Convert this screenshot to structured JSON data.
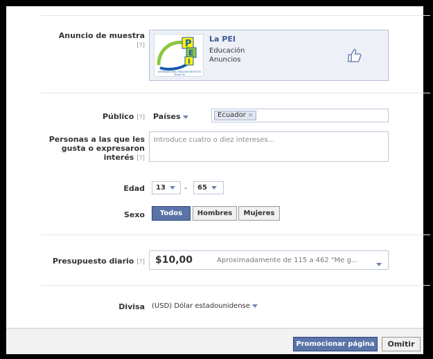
{
  "sample_ad": {
    "label": "Anuncio de muestra",
    "help": "[?]",
    "page_name": "La PEI",
    "category": "Educación",
    "type": "Anuncios",
    "logo_letters": [
      "P",
      "E",
      "I"
    ],
    "logo_caption": "INTERNATIONAL ENGLISH INSTITUTE",
    "logo_sub": "Stand Up"
  },
  "audience": {
    "label": "Público",
    "help": "[?]",
    "location_type": "Países",
    "country_token": "Ecuador",
    "token_remove": "×"
  },
  "interests": {
    "label_line1": "Personas a las que les",
    "label_line2": "gusta o expresaron",
    "label_line3": "interés",
    "help": "[?]",
    "placeholder": "Introduce cuatro o diez intereses..."
  },
  "age": {
    "label": "Edad",
    "min": "13",
    "separator": "-",
    "max": "65"
  },
  "gender": {
    "label": "Sexo",
    "options": [
      "Todos",
      "Hombres",
      "Mujeres"
    ],
    "selected": "Todos"
  },
  "budget": {
    "label": "Presupuesto diario",
    "help": "[?]",
    "amount": "$10,00",
    "estimate": "Aproximadamente de 115 a 462 \"Me g..."
  },
  "currency": {
    "label": "Divisa",
    "value": "(USD) Dólar estadounidense"
  },
  "footer": {
    "promote_label": "Promocionar página",
    "skip_label": "Omitir"
  },
  "colors": {
    "accent": "#3b5998",
    "primary_button": "#5b74a8",
    "logo_green": "#8dc63f",
    "logo_yellow": "#fff200",
    "logo_blue": "#1a5cae"
  }
}
